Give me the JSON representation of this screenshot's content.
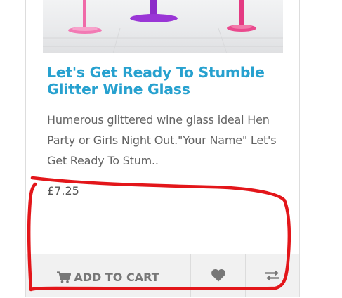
{
  "product": {
    "title": "Let's Get Ready To Stumble Glitter Wine Glass",
    "description": "Humerous glittered wine glass ideal Hen Party or Girls Night Out.\"Your Name\" Let's Get Ready To Stum..",
    "price": "£7.25"
  },
  "actions": {
    "add_to_cart_label": "ADD TO CART",
    "add_to_cart_icon": "shopping-cart-icon",
    "wishlist_icon": "heart-icon",
    "compare_icon": "compare-arrows-icon"
  },
  "colors": {
    "title": "#27a1cf",
    "annotation": "#e3161a",
    "action_bar": "#f1f1f1",
    "icon": "#777777"
  }
}
